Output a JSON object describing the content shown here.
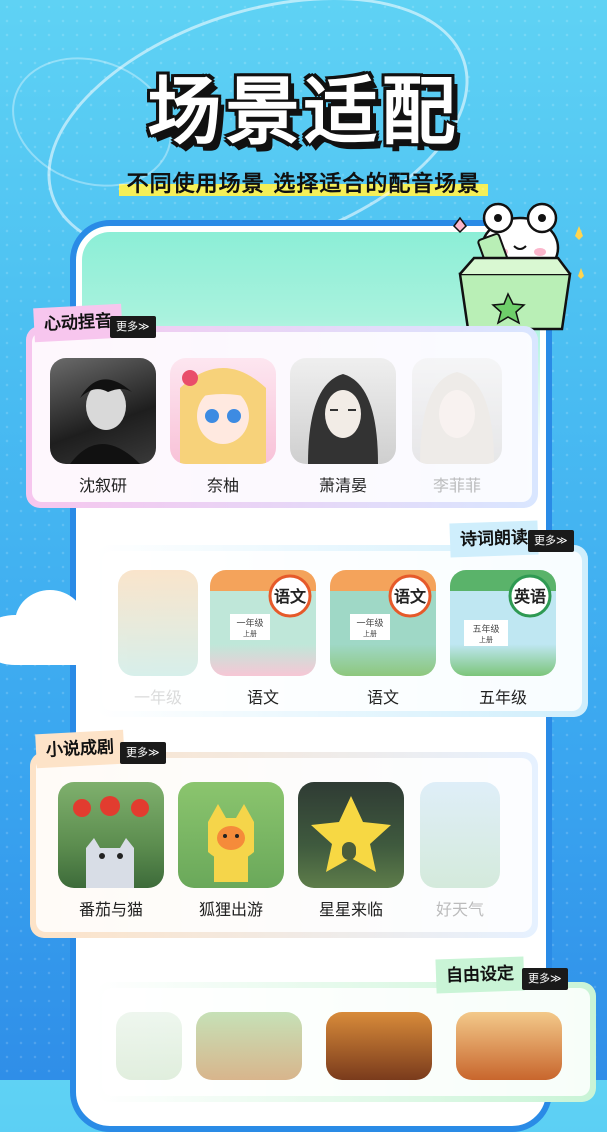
{
  "title": "场景适配",
  "subtitle": "不同使用场景 选择适合的配音场景",
  "more_label": "更多≫",
  "colors": {
    "background": "#4cc0f2",
    "phone_border": "#2a8be6",
    "highlight": "#f5ef57"
  },
  "sections": [
    {
      "tag": "心动捏音",
      "tag_color": "#f7c6ee",
      "items": [
        {
          "label": "沈叙研",
          "icon": "avatar-man-dark"
        },
        {
          "label": "奈柚",
          "icon": "avatar-anime-girl"
        },
        {
          "label": "萧清晏",
          "icon": "avatar-ink-man"
        },
        {
          "label": "李菲菲",
          "icon": "avatar-girl-light"
        }
      ]
    },
    {
      "tag": "诗词朗读",
      "tag_color": "#cfeefc",
      "items": [
        {
          "label": "一年级",
          "icon": "textbook-chinese"
        },
        {
          "label": "语文",
          "icon": "textbook-chinese"
        },
        {
          "label": "语文",
          "icon": "textbook-chinese"
        },
        {
          "label": "五年级",
          "icon": "textbook-english"
        }
      ]
    },
    {
      "tag": "小说成剧",
      "tag_color": "#fde3c8",
      "items": [
        {
          "label": "番茄与猫",
          "icon": "cover-tomato-cat"
        },
        {
          "label": "狐狸出游",
          "icon": "cover-fox"
        },
        {
          "label": "星星来临",
          "icon": "cover-star"
        },
        {
          "label": "好天气",
          "icon": "cover-weather"
        }
      ]
    },
    {
      "tag": "自由设定",
      "tag_color": "#c9f4d6",
      "items": [
        {
          "label": "",
          "icon": "cover-misc"
        },
        {
          "label": "",
          "icon": "cover-rabbit"
        },
        {
          "label": "",
          "icon": "cover-warrior"
        },
        {
          "label": "",
          "icon": "cover-ship"
        }
      ]
    }
  ]
}
